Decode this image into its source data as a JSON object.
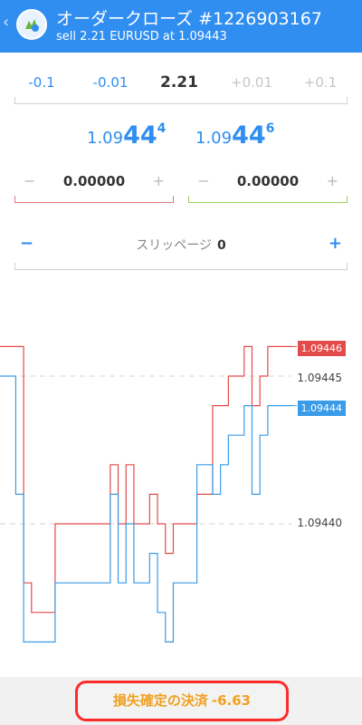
{
  "header": {
    "title": "オーダークローズ #1226903167",
    "subtitle": "sell 2.21 EURUSD at 1.09443"
  },
  "volume": {
    "steps": [
      "-0.1",
      "-0.01",
      "2.21",
      "+0.01",
      "+0.1"
    ]
  },
  "prices": {
    "bid": {
      "base": "1.09",
      "big": "44",
      "sup": "4"
    },
    "ask": {
      "base": "1.09",
      "big": "44",
      "sup": "6"
    }
  },
  "stop_loss": {
    "value": "0.00000",
    "minus": "−",
    "plus": "+"
  },
  "take_profit": {
    "value": "0.00000",
    "minus": "−",
    "plus": "+"
  },
  "slippage": {
    "label": "スリッページ",
    "value": "0",
    "minus": "−",
    "plus": "+"
  },
  "chart": {
    "ask_tag": "1.09446",
    "bid_tag": "1.09444",
    "level_high": "1.09445",
    "level_low": "1.09440",
    "colors": {
      "ask": "#e34b4b",
      "bid": "#3a9be8"
    }
  },
  "chart_data": {
    "type": "line",
    "y_ticks": [
      "1.09445",
      "1.09440"
    ],
    "series": [
      {
        "name": "ask",
        "color": "#e34b4b",
        "values": [
          1.09446,
          1.09446,
          1.09446,
          1.09438,
          1.09437,
          1.09437,
          1.09437,
          1.0944,
          1.0944,
          1.0944,
          1.0944,
          1.0944,
          1.0944,
          1.0944,
          1.09442,
          1.0944,
          1.09442,
          1.0944,
          1.0944,
          1.09441,
          1.0944,
          1.09439,
          1.0944,
          1.0944,
          1.0944,
          1.09441,
          1.09441,
          1.09444,
          1.09444,
          1.09445,
          1.09445,
          1.09446,
          1.09444,
          1.09445,
          1.09446,
          1.09446,
          1.09446,
          1.09446
        ]
      },
      {
        "name": "bid",
        "color": "#3a9be8",
        "values": [
          1.09445,
          1.09445,
          1.09441,
          1.09436,
          1.09436,
          1.09436,
          1.09436,
          1.09438,
          1.09438,
          1.09438,
          1.09438,
          1.09438,
          1.09438,
          1.09438,
          1.09441,
          1.09438,
          1.0944,
          1.09438,
          1.09438,
          1.09439,
          1.09437,
          1.09436,
          1.09438,
          1.09438,
          1.09438,
          1.09442,
          1.09442,
          1.09441,
          1.09442,
          1.09443,
          1.09443,
          1.09444,
          1.09441,
          1.09443,
          1.09444,
          1.09444,
          1.09444,
          1.09444
        ]
      }
    ]
  },
  "footer": {
    "close_label": "損失確定の決済",
    "close_amount": "-6.63"
  }
}
